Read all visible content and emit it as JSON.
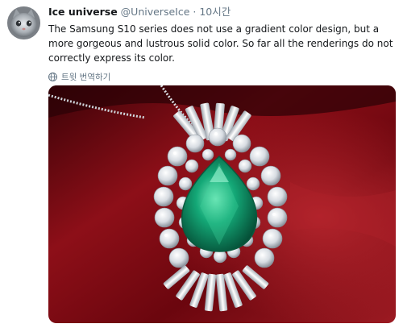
{
  "tweet": {
    "display_name": "Ice universe",
    "handle": "@UniverseIce",
    "separator": "·",
    "timestamp": "10시간",
    "text": "The Samsung S10 series does not use a gradient color design, but a more gorgeous and lustrous solid color. So far all the renderings do not correctly express its color.",
    "translate_label": "트윗 번역하기",
    "translate_icon": "globe-icon",
    "avatar_icon": "cat-avatar"
  },
  "colors": {
    "name": "#14171a",
    "secondary": "#657786",
    "velvet": "#8a0b14",
    "emerald": "#0f9a6e"
  }
}
